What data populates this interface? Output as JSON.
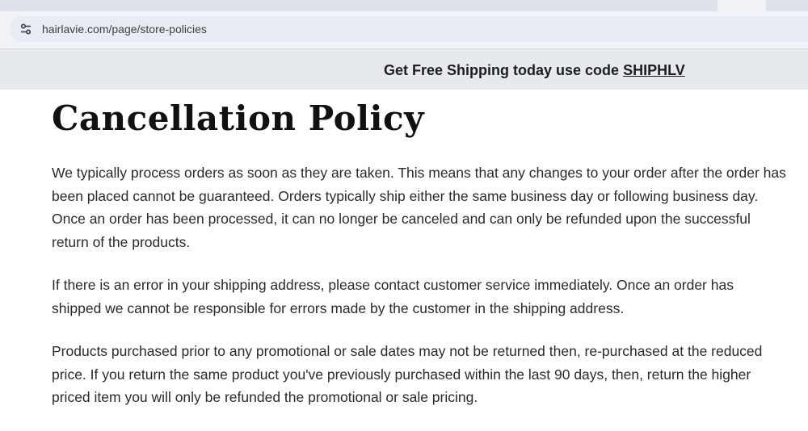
{
  "browser": {
    "url": "hairlavie.com/page/store-policies",
    "site_info_icon": "tune-icon"
  },
  "promo": {
    "text": "Get Free Shipping today use code ",
    "code": "SHIPHLV"
  },
  "page": {
    "title": "Cancellation Policy",
    "paragraphs": [
      "We typically process orders as soon as they are taken. This means that any changes to your order after the order has been placed cannot be guaranteed. Orders typically ship either the same business day or following business day. Once an order has been processed, it can no longer be canceled and can only be refunded upon the successful return of the products.",
      "If there is an error in your shipping address, please contact customer service immediately. Once an order has shipped we cannot be responsible for errors made by the customer in the shipping address.",
      "Products purchased prior to any promotional or sale dates may not be returned then, re-purchased at the reduced price. If you return the same product you've previously purchased within the last 90 days, then, return the higher priced item you will only be refunded the promotional or sale pricing."
    ]
  },
  "colors": {
    "browser_chrome": "#f1f3f8",
    "promo_background": "#e6e9ee",
    "text": "#2a2a2a"
  }
}
